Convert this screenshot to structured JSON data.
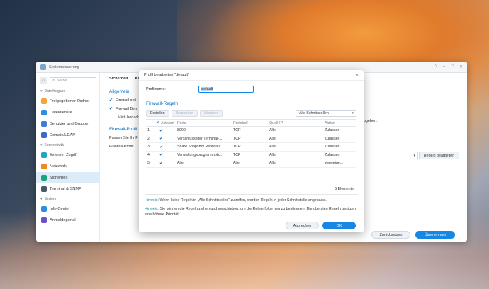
{
  "window": {
    "title": "Systemsteuerung",
    "controls": [
      "?",
      "–",
      "□",
      "✕"
    ]
  },
  "sidebar": {
    "search_placeholder": "Suche",
    "sections": [
      {
        "label": "Dateifreigabe",
        "items": [
          {
            "label": "Freigegebener Ordner",
            "icon": "folder-icon",
            "color": "#f2a33a"
          },
          {
            "label": "Dateidienste",
            "icon": "file-services-icon",
            "color": "#2e8de0"
          },
          {
            "label": "Benutzer und Gruppe",
            "icon": "users-icon",
            "color": "#3f7bd6"
          },
          {
            "label": "Domain/LDAP",
            "icon": "domain-icon",
            "color": "#3b69c8"
          }
        ]
      },
      {
        "label": "Konnektivität",
        "items": [
          {
            "label": "Externer Zugriff",
            "icon": "globe-icon",
            "color": "#1fa5c9"
          },
          {
            "label": "Netzwerk",
            "icon": "network-icon",
            "color": "#f08a24"
          },
          {
            "label": "Sicherheit",
            "icon": "shield-icon",
            "color": "#1aa37a",
            "active": true
          },
          {
            "label": "Terminal & SNMP",
            "icon": "terminal-icon",
            "color": "#4a5766"
          }
        ]
      },
      {
        "label": "System",
        "items": [
          {
            "label": "Info-Center",
            "icon": "info-icon",
            "color": "#2e8de0"
          },
          {
            "label": "Anmeldeportal",
            "icon": "portal-icon",
            "color": "#6e4fc9"
          }
        ]
      }
    ]
  },
  "content": {
    "tabs": [
      "Sicherheit",
      "Ko"
    ],
    "general_title": "Allgemein",
    "firewall_activate": "Firewall akti",
    "firewall_notify": "Firewall Ben",
    "notify_text": "Mich benach",
    "notify_right": "zugeben.",
    "profile_section": "Firewall-Profil",
    "profile_hint": "Passen Sie Ihr F",
    "profile_label": "Firewall-Profil:",
    "edit_rules_button": "Regeln bearbeiten",
    "reset_button": "Zurücksetzen",
    "apply_button": "Übernehmen"
  },
  "dialog": {
    "title": "Profil bearbeiten \"default\"",
    "profile_name_label": "Profilname:",
    "profile_name_value": "default",
    "rules_title": "Firewall-Regeln",
    "toolbar": {
      "create": "Erstellen",
      "edit": "Bearbeiten",
      "delete": "Löschen"
    },
    "interface_select": "Alle Schnittstellen",
    "columns": {
      "activated": "Aktiviert",
      "ports": "Ports",
      "protocol": "Protokoll",
      "source_ip": "Quell-IP",
      "action": "Aktion"
    },
    "rules": [
      {
        "num": "1",
        "ports": "8000",
        "protocol": "TCP",
        "source": "Alle",
        "action": "Zulassen"
      },
      {
        "num": "2",
        "ports": "Verschlüsselter Terminal-...",
        "protocol": "TCP",
        "source": "Alle",
        "action": "Zulassen"
      },
      {
        "num": "3",
        "ports": "Share Snapshot Replicati...",
        "protocol": "TCP",
        "source": "Alle",
        "action": "Zulassen"
      },
      {
        "num": "4",
        "ports": "Verwaltungsprogrammob...",
        "protocol": "TCP",
        "source": "Alle",
        "action": "Zulassen"
      },
      {
        "num": "5",
        "ports": "Alle",
        "protocol": "Alle",
        "source": "Alle",
        "action": "Verweige..."
      }
    ],
    "count": "5 Elemente",
    "hint1_label": "Hinweis:",
    "hint1": "Wenn keine Regeln in „Alle Schnittstellen“ zutreffen, werden Regeln in jeder Schnittstelle angepasst.",
    "hint2_label": "Hinweis:",
    "hint2": "Sie können die Regeln ziehen und verschieben, um die Reihenfolge neu zu bestimmen. Die obersten Regeln besitzen eine höhere Priorität.",
    "cancel_button": "Abbrechen",
    "ok_button": "OK"
  }
}
